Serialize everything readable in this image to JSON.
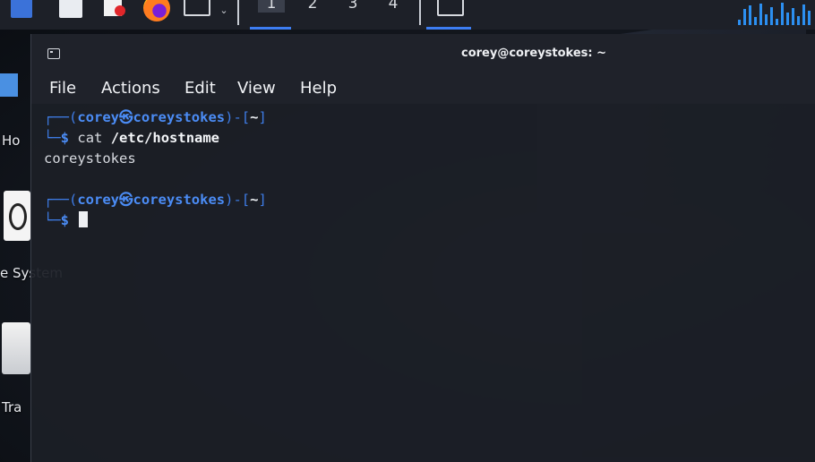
{
  "taskbar": {
    "workspaces": [
      "1",
      "2",
      "3",
      "4"
    ],
    "active_workspace": "1",
    "icons": [
      "app-menu-icon",
      "file-manager-icon",
      "text-editor-icon",
      "firefox-icon",
      "terminal-icon",
      "terminal-window-icon"
    ],
    "accent_color": "#3d7df2"
  },
  "desktop": {
    "home_label": "Ho",
    "filesystem_label": "e System",
    "trash_label": "Tra"
  },
  "window": {
    "title": "corey@coreystokes: ~"
  },
  "menubar": {
    "file": "File",
    "actions": "Actions",
    "edit": "Edit",
    "view": "View",
    "help": "Help"
  },
  "terminal": {
    "prompt1": {
      "frame_top": "┌──(",
      "user_host": "corey㉿coreystokes",
      "dir_open": ")-[",
      "dir": "~",
      "dir_close": "]",
      "frame_bottom": "└─",
      "dollar": "$",
      "command": "cat",
      "argument": "/etc/hostname"
    },
    "output": "coreystokes",
    "prompt2": {
      "frame_top": "┌──(",
      "user_host": "corey㉿coreystokes",
      "dir_open": ")-[",
      "dir": "~",
      "dir_close": "]",
      "frame_bottom": "└─",
      "dollar": "$"
    },
    "colors": {
      "prompt": "#4b8cf5",
      "text": "#d7dae0",
      "background": "#1c1f26"
    }
  }
}
